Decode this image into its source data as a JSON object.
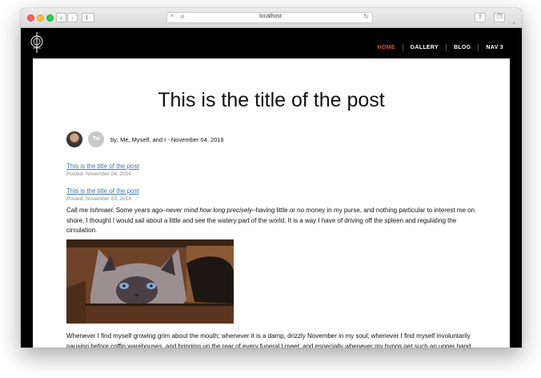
{
  "browser": {
    "url": "localhost"
  },
  "site": {
    "nav": [
      {
        "label": "HOME"
      },
      {
        "label": "GALLERY"
      },
      {
        "label": "BLOG"
      },
      {
        "label": "NAV 3"
      }
    ],
    "accent_color": "#e8503a"
  },
  "post": {
    "title": "This is the title of the post",
    "avatar2_initials": "Tw",
    "byline": "by: Me, Myself, and I - November 04, 2016",
    "entries": [
      {
        "link": "This is the title of the post",
        "date": "Posted: November 04, 2016"
      },
      {
        "link": "This is the title of the post",
        "date": "Posted: November 03, 2016"
      }
    ],
    "para1": {
      "a": "Call me ",
      "b": "Ishmael",
      "c": ". Some years ago–",
      "d": "never mind how long precisely",
      "e": "–having little or no money in my purse, and nothing particular to interest me on shore, I thought I would sail about a little and see the watery part of the world. It is a way I have of driving off the spleen and regulating the circulation."
    },
    "para2": "Whenever I find myself growing grim about the mouth; whenever it is a damp, drizzly November in my soul; whenever I find myself involuntarily pausing before coffin warehouses, and bringing up the rear of every funeral I meet; and especially whenever my hypos get such an upper hand of me, that it requires a strong moral principle to prevent me from deliberately stepping into the street"
  }
}
